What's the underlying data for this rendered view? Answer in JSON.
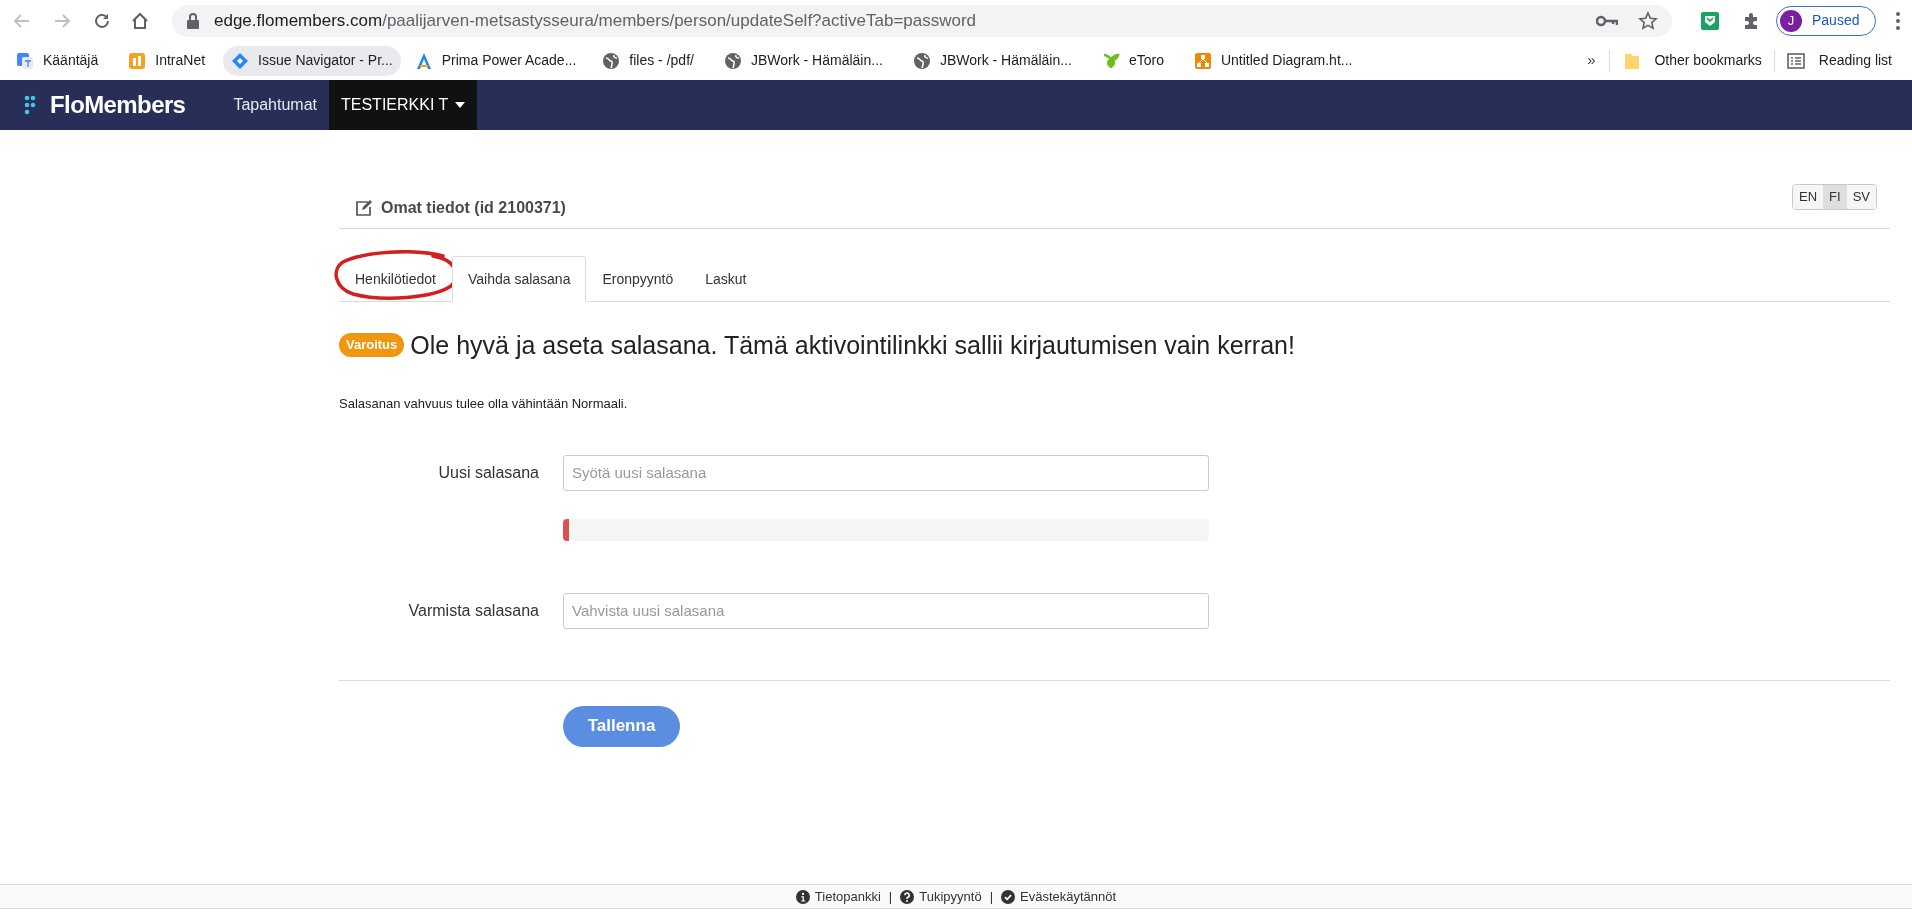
{
  "browser": {
    "url_host": "edge.flomembers.com",
    "url_path": "/paalijarven-metsastysseura/members/person/updateSelf?activeTab=password",
    "profile_initial": "J",
    "profile_status": "Paused"
  },
  "bookmarks": [
    {
      "label": "Kääntäjä",
      "highlighted": false
    },
    {
      "label": "IntraNet",
      "highlighted": false
    },
    {
      "label": "Issue Navigator - Pr...",
      "highlighted": true
    },
    {
      "label": "Prima Power Acade...",
      "highlighted": false
    },
    {
      "label": "files - /pdf/",
      "highlighted": false
    },
    {
      "label": "JBWork - Hämäläin...",
      "highlighted": false
    },
    {
      "label": "JBWork - Hämäläin...",
      "highlighted": false
    },
    {
      "label": "eToro",
      "highlighted": false
    },
    {
      "label": "Untitled Diagram.ht...",
      "highlighted": false
    }
  ],
  "bookmarks_more": "»",
  "other_bookmarks": "Other bookmarks",
  "reading_list": "Reading list",
  "navbar": {
    "brand": "FloMembers",
    "items": [
      {
        "label": "Tapahtumat",
        "selected": false,
        "dropdown": false
      },
      {
        "label": "TESTIERKKI T",
        "selected": true,
        "dropdown": true
      }
    ]
  },
  "page": {
    "title": "Omat tiedot (id 2100371)",
    "languages": [
      {
        "label": "EN",
        "selected": false
      },
      {
        "label": "FI",
        "selected": true
      },
      {
        "label": "SV",
        "selected": false
      }
    ],
    "tabs": [
      {
        "label": "Henkilötiedot",
        "selected": false,
        "circled": true
      },
      {
        "label": "Vaihda salasana",
        "selected": true,
        "circled": false
      },
      {
        "label": "Eronpyyntö",
        "selected": false,
        "circled": false
      },
      {
        "label": "Laskut",
        "selected": false,
        "circled": false
      }
    ],
    "warning_badge": "Varoitus",
    "warning_text": "Ole hyvä ja aseta salasana. Tämä aktivointilinkki sallii kirjautumisen vain kerran!",
    "help_text": "Salasanan vahvuus tulee olla vähintään Normaali.",
    "new_password": {
      "label": "Uusi salasana",
      "placeholder": "Syötä uusi salasana"
    },
    "strength_meter": {
      "level": 0.01
    },
    "confirm_password": {
      "label": "Varmista salasana",
      "placeholder": "Vahvista uusi salasana"
    },
    "save_button": "Tallenna"
  },
  "footer": [
    {
      "kind": "link",
      "label": "Tietopankki"
    },
    {
      "kind": "separator",
      "label": "|"
    },
    {
      "kind": "link",
      "label": "Tukipyyntö"
    },
    {
      "kind": "separator",
      "label": "|"
    },
    {
      "kind": "link",
      "label": "Evästekäytännöt"
    }
  ]
}
